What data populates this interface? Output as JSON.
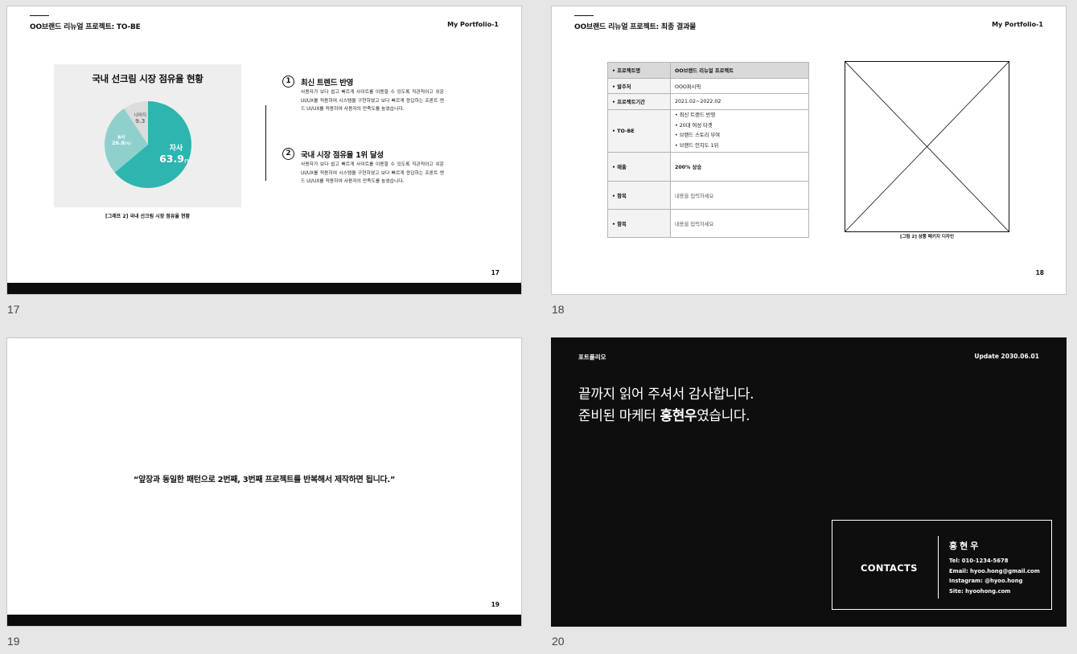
{
  "slides": [
    {
      "number": "17",
      "header_title": "OO브랜드 리뉴얼 프로젝트: TO-BE",
      "header_right": "My Portfolio-1",
      "chart_caption": "[그래프 2] 국내 선크림 시장 점유율 현황",
      "points": [
        {
          "marker": "1",
          "title": "최신 트렌드 반영",
          "body": "사용자가 보다 쉽고 빠르게 사이트를 이용할 수 있도록 직관적이고 쉬운 UI/UX를 적용하여 시스템을 구현하였고 보다 빠르게 응답하는 프론트 엔드 UI/UX를 적용하여 사용자의 만족도를 높였습니다."
        },
        {
          "marker": "2",
          "title": "국내 시장 점유율 1위 달성",
          "body": "사용자가 보다 쉽고 빠르게 사이트를 이용할 수 있도록 직관적이고 쉬운 UI/UX를 적용하여 시스템을 구현하였고 보다 빠르게 응답하는 프론트 엔드 UI/UX를 적용하여 사용자의 만족도를 높였습니다."
        }
      ]
    },
    {
      "number": "18",
      "header_title": "OO브랜드 리뉴얼 프로젝트: 최종 결과물",
      "header_right": "My Portfolio-1",
      "table": [
        {
          "key": "• 프로젝트명",
          "value": "OO브랜드 리뉴얼 프로젝트"
        },
        {
          "key": "• 발주처",
          "value": "OOO퍼시픽"
        },
        {
          "key": "• 프로젝트기간",
          "value": "2021.02~2022.02"
        },
        {
          "key": "• TO-BE",
          "list": [
            "• 최신 트렌드 반영",
            "• 20대 여성 타겟",
            "• 브랜드 스토리 부여",
            "• 브랜드 인지도 1위"
          ]
        },
        {
          "key": "• 매출",
          "value": "200% 상승"
        },
        {
          "key": "• 항목",
          "value": "내용을 입력하세요"
        },
        {
          "key": "• 항목",
          "value": "내용을 입력하세요"
        }
      ],
      "image_caption": "[그림 2] 상품 페키지 디자인"
    },
    {
      "number": "19",
      "quote": "“앞장과 동일한 패턴으로 2번째, 3번째 프로젝트를 반복해서 제작하면 됩니다.”"
    },
    {
      "number": "20",
      "top_left": "포트폴리오",
      "top_right": "Update 2030.06.01",
      "thanks_line1": "끝까지 읽어 주셔서 감사합니다.",
      "thanks_line2_pre": "준비된 마케터 ",
      "thanks_line2_name": "홍현우",
      "thanks_line2_post": "였습니다.",
      "contacts_label": "CONTACTS",
      "contact_name": "홍현우",
      "contact_lines": [
        "Tel: 010-1234-5678",
        "Email: hyoo.hong@gmail.com",
        "Instagram: @hyoo.hong",
        "Site: hyoohong.com"
      ]
    }
  ],
  "colors": {
    "pie_main": "#2fb5b0",
    "pie_second": "#8fd0cd",
    "pie_third": "#dcdcdc",
    "dark_bg": "#0e0e0e"
  },
  "chart_data": {
    "type": "pie",
    "title": "국내 선크림 시장 점유율 현황",
    "slices": [
      {
        "label": "자사",
        "value": 63.9,
        "unit": "(%)"
      },
      {
        "label": "B사",
        "value": 26.8,
        "unit": "(%)"
      },
      {
        "label": "나머지",
        "value": 9.3,
        "unit": ""
      }
    ]
  }
}
